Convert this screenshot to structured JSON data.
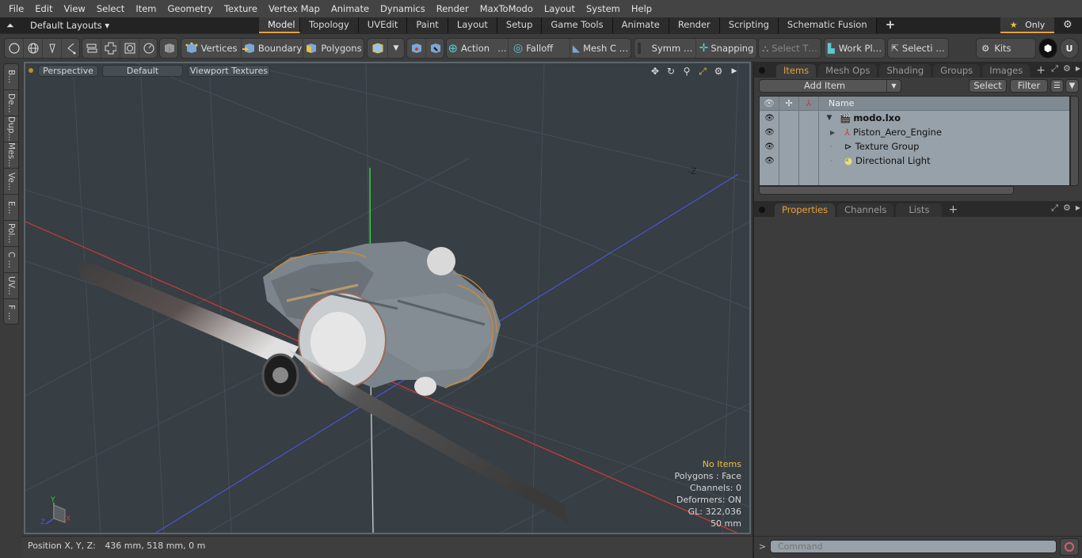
{
  "menu": [
    "File",
    "Edit",
    "View",
    "Select",
    "Item",
    "Geometry",
    "Texture",
    "Vertex Map",
    "Animate",
    "Dynamics",
    "Render",
    "MaxToModo",
    "Layout",
    "System",
    "Help"
  ],
  "layout_bar": {
    "layouts_label": "Default Layouts ▾",
    "tabs": [
      "Model",
      "Topology",
      "UVEdit",
      "Paint",
      "Layout",
      "Setup",
      "Game Tools",
      "Animate",
      "Render",
      "Scripting",
      "Schematic Fusion"
    ],
    "active_tab": "Model",
    "add_tab": "+",
    "only_label": "Only"
  },
  "toolbar": {
    "vertices": "Vertices",
    "boundary": "Boundary",
    "polygons": "Polygons",
    "action": "Action",
    "action_more": "…",
    "falloff": "Falloff",
    "mesh_c": "Mesh C …",
    "symm": "Symm …",
    "snapping": "Snapping",
    "select_t": "Select T…",
    "work_pl": "Work Pl…",
    "selecti": "Selecti …",
    "kits": "Kits"
  },
  "left_tabs": [
    "B...",
    "De...",
    "Dup...",
    "Mes...",
    "Ve...",
    "E...",
    "Pol...",
    "C ...",
    "UV...",
    "F ..."
  ],
  "viewport": {
    "view_mode": "Perspective",
    "shading": "Default",
    "textures": "Viewport Textures",
    "axis_label_neg_z": "-Z",
    "gizmo": {
      "y": "Y",
      "x": "X",
      "z": "Z"
    },
    "info": {
      "selection": "No Items",
      "polygons": "Polygons : Face",
      "channels": "Channels: 0",
      "deformers": "Deformers: ON",
      "gl": "GL: 322,036",
      "scale": "50 mm"
    }
  },
  "status": {
    "position_label": "Position X, Y, Z:",
    "position_value": "436 mm, 518 mm, 0 m"
  },
  "items_panel": {
    "tabs": [
      "Items",
      "Mesh Ops",
      "Shading",
      "Groups",
      "Images"
    ],
    "active_tab": "Items",
    "add_item": "Add Item",
    "select": "Select",
    "filter": "Filter",
    "name_header": "Name",
    "rows": [
      {
        "name": "modo.lxo",
        "indent": 0,
        "bold": true,
        "expander": "▼",
        "icon": "scene-icon"
      },
      {
        "name": "Piston_Aero_Engine",
        "indent": 1,
        "bold": false,
        "expander": "▶",
        "icon": "mesh-locator-icon"
      },
      {
        "name": "Texture Group",
        "indent": 1,
        "bold": false,
        "expander": "",
        "icon": "texture-group-icon"
      },
      {
        "name": "Directional Light",
        "indent": 1,
        "bold": false,
        "expander": "",
        "icon": "light-icon"
      }
    ]
  },
  "props_panel": {
    "tabs": [
      "Properties",
      "Channels",
      "Lists"
    ],
    "active_tab": "Properties"
  },
  "command": {
    "prompt": ">",
    "placeholder": "Command"
  },
  "colors": {
    "accent": "#e8a13a",
    "viewport_bg": "#373e44",
    "axis_x": "#d03a3a",
    "axis_y": "#3ad03a",
    "axis_z": "#3a4ad0"
  }
}
